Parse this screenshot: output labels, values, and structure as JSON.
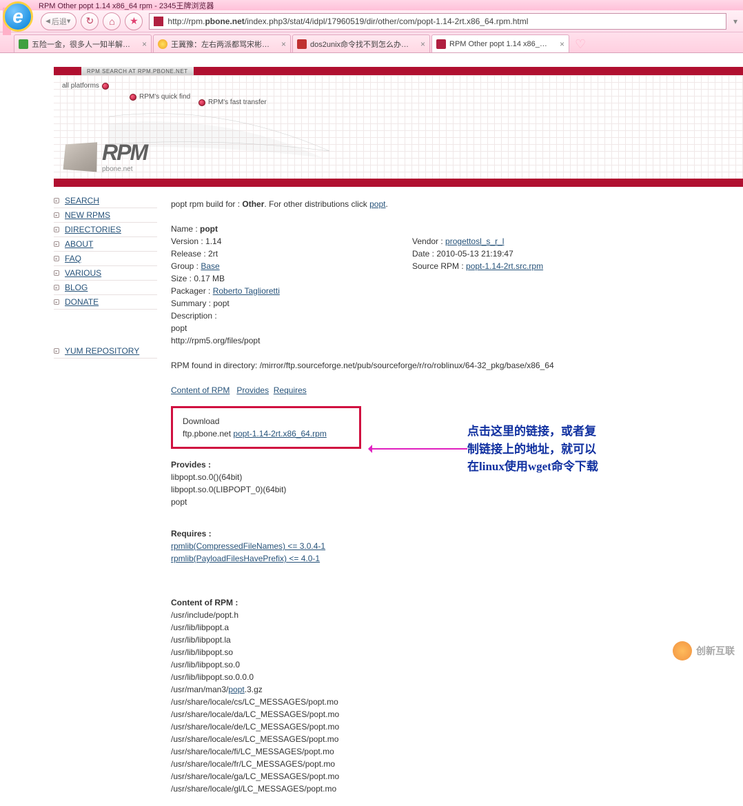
{
  "browser": {
    "title": "RPM Other popt 1.14 x86_64 rpm - 2345王牌浏览器",
    "back_label": "后退",
    "url_prefix": "http://rpm.",
    "url_domain": "pbone.net",
    "url_path": "/index.php3/stat/4/idpl/17960519/dir/other/com/popt-1.14-2rt.x86_64.rpm.html"
  },
  "tabs": [
    {
      "label": "五险一金，很多人一知半解…"
    },
    {
      "label": "王冀豫：左右两派都骂宋彬…"
    },
    {
      "label": "dos2unix命令找不到怎么办…"
    },
    {
      "label": "RPM Other popt 1.14 x86_…"
    }
  ],
  "header": {
    "search_badge": "RPM SEARCH AT RPM.PBONE.NET",
    "links": {
      "all": "all platforms",
      "quick": "RPM's quick find",
      "fast": "RPM's fast transfer"
    },
    "logo": "RPM",
    "logo_sub": "pbone.net"
  },
  "sidebar": {
    "items": [
      "SEARCH",
      "NEW RPMS",
      "DIRECTORIES",
      "ABOUT",
      "FAQ",
      "VARIOUS",
      "BLOG",
      "DONATE"
    ],
    "yum": "YUM REPOSITORY"
  },
  "pkg": {
    "intro_pre": "popt rpm build for : ",
    "intro_dist": "Other",
    "intro_post": ". For other distributions click ",
    "intro_link": "popt",
    "name_label": "Name : ",
    "name": "popt",
    "version_label": "Version : 1.14",
    "vendor_label": "Vendor : ",
    "vendor": "progettosl_s_r_l",
    "release_label": "Release : 2rt",
    "date_label": "Date : 2010-05-13 21:19:47",
    "group_label": "Group : ",
    "group": "Base",
    "srcrpm_label": "Source RPM : ",
    "srcrpm": "popt-1.14-2rt.src.rpm",
    "size_label": "Size : 0.17 MB",
    "packager_label": "Packager : ",
    "packager": "Roberto Taglioretti",
    "summary_label": "Summary : popt",
    "desc_label": "Description :",
    "desc1": "popt",
    "desc2": "http://rpm5.org/files/popt",
    "found_label": "RPM found in directory: /mirror/ftp.sourceforge.net/pub/sourceforge/r/ro/roblinux/64-32_pkg/base/x86_64",
    "links": {
      "content": "Content of RPM",
      "provides": "Provides",
      "requires": "Requires"
    },
    "download_label": "Download",
    "download_host": "ftp.pbone.net ",
    "download_file": "popt-1.14-2rt.x86_64.rpm",
    "provides_title": "Provides :",
    "provides": [
      "libpopt.so.0()(64bit)",
      "libpopt.so.0(LIBPOPT_0)(64bit)",
      "popt"
    ],
    "requires_title": "Requires :",
    "requires": [
      "rpmlib(CompressedFileNames) <= 3.0.4-1",
      "rpmlib(PayloadFilesHavePrefix) <= 4.0-1"
    ],
    "content_title": "Content of RPM :",
    "files_pre": [
      "/usr/include/popt.h",
      "/usr/lib/libpopt.a",
      "/usr/lib/libpopt.la",
      "/usr/lib/libpopt.so",
      "/usr/lib/libpopt.so.0",
      "/usr/lib/libpopt.so.0.0.0"
    ],
    "manpage_pre": "/usr/man/man3/",
    "manpage_link": "popt",
    "manpage_post": ".3.gz",
    "files_post": [
      "/usr/share/locale/cs/LC_MESSAGES/popt.mo",
      "/usr/share/locale/da/LC_MESSAGES/popt.mo",
      "/usr/share/locale/de/LC_MESSAGES/popt.mo",
      "/usr/share/locale/es/LC_MESSAGES/popt.mo",
      "/usr/share/locale/fi/LC_MESSAGES/popt.mo",
      "/usr/share/locale/fr/LC_MESSAGES/popt.mo",
      "/usr/share/locale/ga/LC_MESSAGES/popt.mo",
      "/usr/share/locale/gl/LC_MESSAGES/popt.mo"
    ]
  },
  "annotation": {
    "line1": "点击这里的链接，或者复",
    "line2": "制链接上的地址，就可以",
    "line3": "在linux使用wget命令下载"
  },
  "watermark": "创新互联"
}
